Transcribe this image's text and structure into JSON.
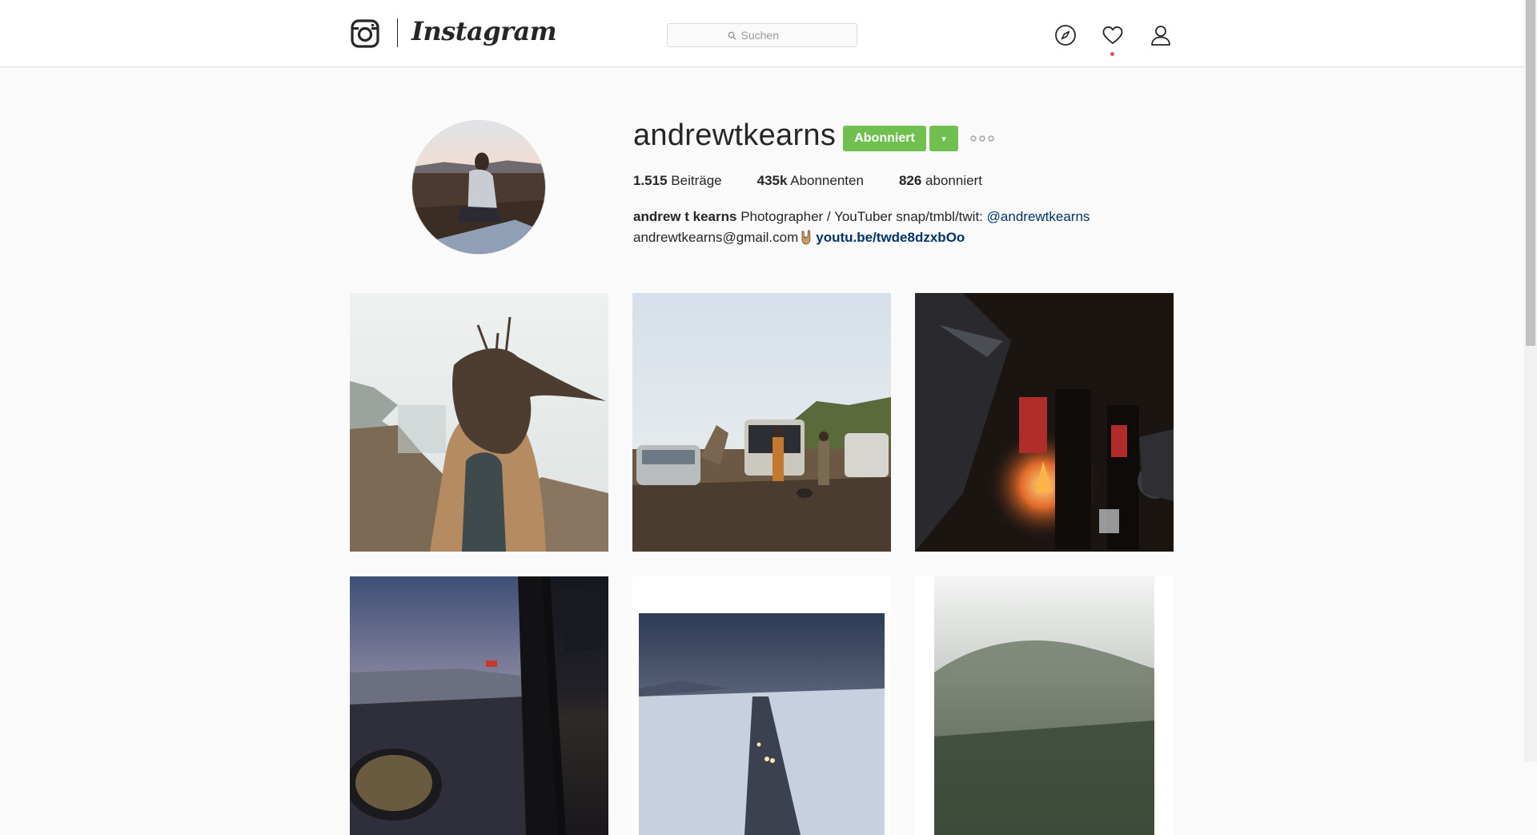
{
  "header": {
    "brand": "Instagram",
    "search_placeholder": "Suchen",
    "icons": [
      "camera-logo-icon",
      "search-icon",
      "compass-icon",
      "heart-icon",
      "user-icon"
    ],
    "notification_dot_color": "#ed4956"
  },
  "profile": {
    "username": "andrewtkearns",
    "follow_label": "Abonniert",
    "follow_dropdown_glyph": "▾",
    "accent_color": "#70c050",
    "stats": [
      {
        "value": "1.515",
        "label": "Beiträge"
      },
      {
        "value": "435k",
        "label": "Abonnenten"
      },
      {
        "value": "826",
        "label": "abonniert"
      }
    ],
    "bio": {
      "full_name": "andrew t kearns",
      "text": "Photographer / YouTuber snap/tmbl/twit:",
      "mention": "@andrewtkearns",
      "email": "andrewtkearns@gmail.com",
      "link": "youtu.be/twde8dzxbOo"
    }
  },
  "posts": [
    {
      "subject": "woman-hair-wind-cliff"
    },
    {
      "subject": "cars-campsite-coast"
    },
    {
      "subject": "campfire-night"
    },
    {
      "subject": "car-window-sunset"
    },
    {
      "subject": "road-winter-dusk"
    },
    {
      "subject": "foggy-forest"
    }
  ]
}
